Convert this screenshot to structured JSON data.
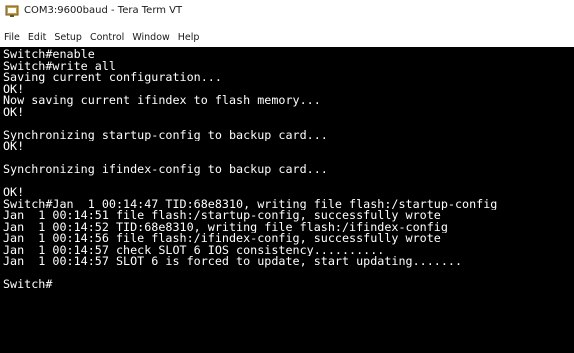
{
  "window": {
    "title": "COM3:9600baud - Tera Term VT"
  },
  "menu": {
    "items": [
      "File",
      "Edit",
      "Setup",
      "Control",
      "Window",
      "Help"
    ]
  },
  "terminal": {
    "lines": [
      "Switch#enable",
      "Switch#write all",
      "Saving current configuration...",
      "OK!",
      "Now saving current ifindex to flash memory...",
      "OK!",
      "",
      "Synchronizing startup-config to backup card...",
      "OK!",
      "",
      "Synchronizing ifindex-config to backup card...",
      "",
      "OK!",
      "Switch#Jan  1 00:14:47 TID:68e8310, writing file flash:/startup-config",
      "Jan  1 00:14:51 file flash:/startup-config, successfully wrote",
      "Jan  1 00:14:52 TID:68e8310, writing file flash:/ifindex-config",
      "Jan  1 00:14:56 file flash:/ifindex-config, successfully wrote",
      "Jan  1 00:14:57 check SLOT 6 IOS consistency..........",
      "Jan  1 00:14:57 SLOT 6 is forced to update, start updating.......",
      "",
      "Switch#"
    ]
  },
  "colors": {
    "terminal_bg": "#000000",
    "terminal_fg": "#ffffff"
  }
}
